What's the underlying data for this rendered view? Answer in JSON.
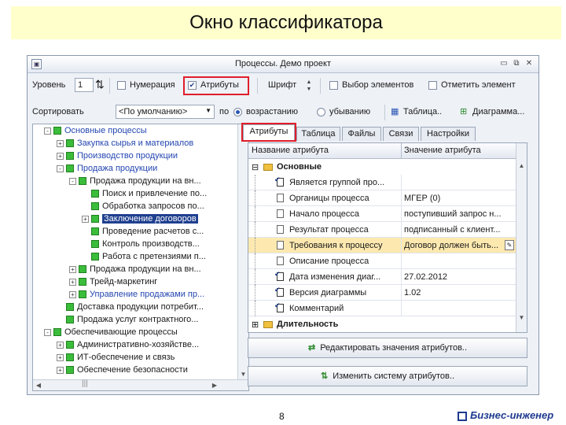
{
  "slide": {
    "title": "Окно классификатора",
    "page_number": "8",
    "brand": "Бизнес-инженер",
    "brand_color": "#1f3a8f"
  },
  "window": {
    "title": "Процессы. Демо проект",
    "icons": {
      "app": "app-icon",
      "minimize": "minimize-icon",
      "maximize": "maximize-icon",
      "close": "close-icon"
    }
  },
  "toolbar1": {
    "level_label": "Уровень",
    "level_value": "1",
    "numbering_label": "Нумерация",
    "numbering_checked": false,
    "attributes_label": "Атрибуты",
    "attributes_checked": true,
    "font_label": "Шрифт",
    "select_elements_label": "Выбор элементов",
    "mark_element_label": "Отметить элемент",
    "highlight_color": "#e01e2a"
  },
  "toolbar2": {
    "sort_label": "Сортировать",
    "sort_value": "<По умолчанию>",
    "by_label": "по",
    "ascending_label": "возрастанию",
    "descending_label": "убыванию",
    "ascending_selected": true,
    "table_button": "Таблица..",
    "diagram_button": "Диаграмма..."
  },
  "tree": {
    "selection_color": "#1f3f8f",
    "items": [
      {
        "label": "Основные процессы",
        "level": 1,
        "expander": "-",
        "blue": true,
        "selected": false
      },
      {
        "label": "Закупка сырья и материалов",
        "level": 2,
        "expander": "+",
        "blue": true,
        "selected": false
      },
      {
        "label": "Производство продукции",
        "level": 2,
        "expander": "+",
        "blue": true,
        "selected": false
      },
      {
        "label": "Продажа продукции",
        "level": 2,
        "expander": "-",
        "blue": true,
        "selected": false
      },
      {
        "label": "Продажа продукции на вн...",
        "level": 3,
        "expander": "-",
        "blue": false,
        "selected": false
      },
      {
        "label": "Поиск и привлечение по...",
        "level": 4,
        "expander": "",
        "blue": false,
        "selected": false
      },
      {
        "label": "Обработка запросов по...",
        "level": 4,
        "expander": "",
        "blue": false,
        "selected": false
      },
      {
        "label": "Заключение договоров",
        "level": 4,
        "expander": "+",
        "blue": false,
        "selected": true
      },
      {
        "label": "Проведение расчетов с...",
        "level": 4,
        "expander": "",
        "blue": false,
        "selected": false
      },
      {
        "label": "Контроль производств...",
        "level": 4,
        "expander": "",
        "blue": false,
        "selected": false
      },
      {
        "label": "Работа с претензиями п...",
        "level": 4,
        "expander": "",
        "blue": false,
        "selected": false
      },
      {
        "label": "Продажа продукции на вн...",
        "level": 3,
        "expander": "+",
        "blue": false,
        "selected": false
      },
      {
        "label": "Трейд-маркетинг",
        "level": 3,
        "expander": "+",
        "blue": false,
        "selected": false
      },
      {
        "label": "Управление продажами пр...",
        "level": 3,
        "expander": "+",
        "blue": true,
        "selected": false
      },
      {
        "label": "Доставка продукции потребит...",
        "level": 2,
        "expander": "",
        "blue": false,
        "selected": false
      },
      {
        "label": "Продажа услуг контрактного...",
        "level": 2,
        "expander": "",
        "blue": false,
        "selected": false
      },
      {
        "label": "Обеспечивающие процессы",
        "level": 1,
        "expander": "-",
        "blue": false,
        "selected": false
      },
      {
        "label": "Административно-хозяйстве...",
        "level": 2,
        "expander": "+",
        "blue": false,
        "selected": false
      },
      {
        "label": "ИТ-обеспечение и связь",
        "level": 2,
        "expander": "+",
        "blue": false,
        "selected": false
      },
      {
        "label": "Обеспечение безопасности",
        "level": 2,
        "expander": "+",
        "blue": false,
        "selected": false
      }
    ]
  },
  "tabs": [
    {
      "label": "Атрибуты",
      "active": true
    },
    {
      "label": "Таблица",
      "active": false
    },
    {
      "label": "Файлы",
      "active": false
    },
    {
      "label": "Связи",
      "active": false
    },
    {
      "label": "Настройки",
      "active": false
    }
  ],
  "attributes": {
    "columns": [
      "Название атрибута",
      "Значение атрибута"
    ],
    "group_main": "Основные",
    "group_duration": "Длительность",
    "highlight_row_color": "#fde9b0",
    "rows": [
      {
        "name": "Является группой про...",
        "value": "",
        "icon": "checkbox-doc-icon",
        "highlight": false
      },
      {
        "name": "Органицы процесса",
        "value": "МГЕР (0)",
        "icon": "doc-icon",
        "highlight": false
      },
      {
        "name": "Начало процесса",
        "value": "поступивший запрос н...",
        "icon": "doc-icon",
        "highlight": false
      },
      {
        "name": "Результат процесса",
        "value": "подписанный с клиент...",
        "icon": "doc-icon",
        "highlight": false
      },
      {
        "name": "Требования к процессу",
        "value": "Договор должен быть...",
        "icon": "doc-icon",
        "highlight": true
      },
      {
        "name": "Описание процесса",
        "value": "",
        "icon": "doc-icon",
        "highlight": false
      },
      {
        "name": "Дата изменения диаг...",
        "value": "27.02.2012",
        "icon": "checkbox-doc-icon",
        "highlight": false
      },
      {
        "name": "Версия диаграммы",
        "value": "1.02",
        "icon": "checkbox-doc-icon",
        "highlight": false
      },
      {
        "name": "Комментарий",
        "value": "",
        "icon": "checkbox-doc-icon",
        "highlight": false
      }
    ]
  },
  "buttons": {
    "edit_values": "Редактировать значения атрибутов..",
    "change_system": "Изменить систему атрибутов.."
  }
}
